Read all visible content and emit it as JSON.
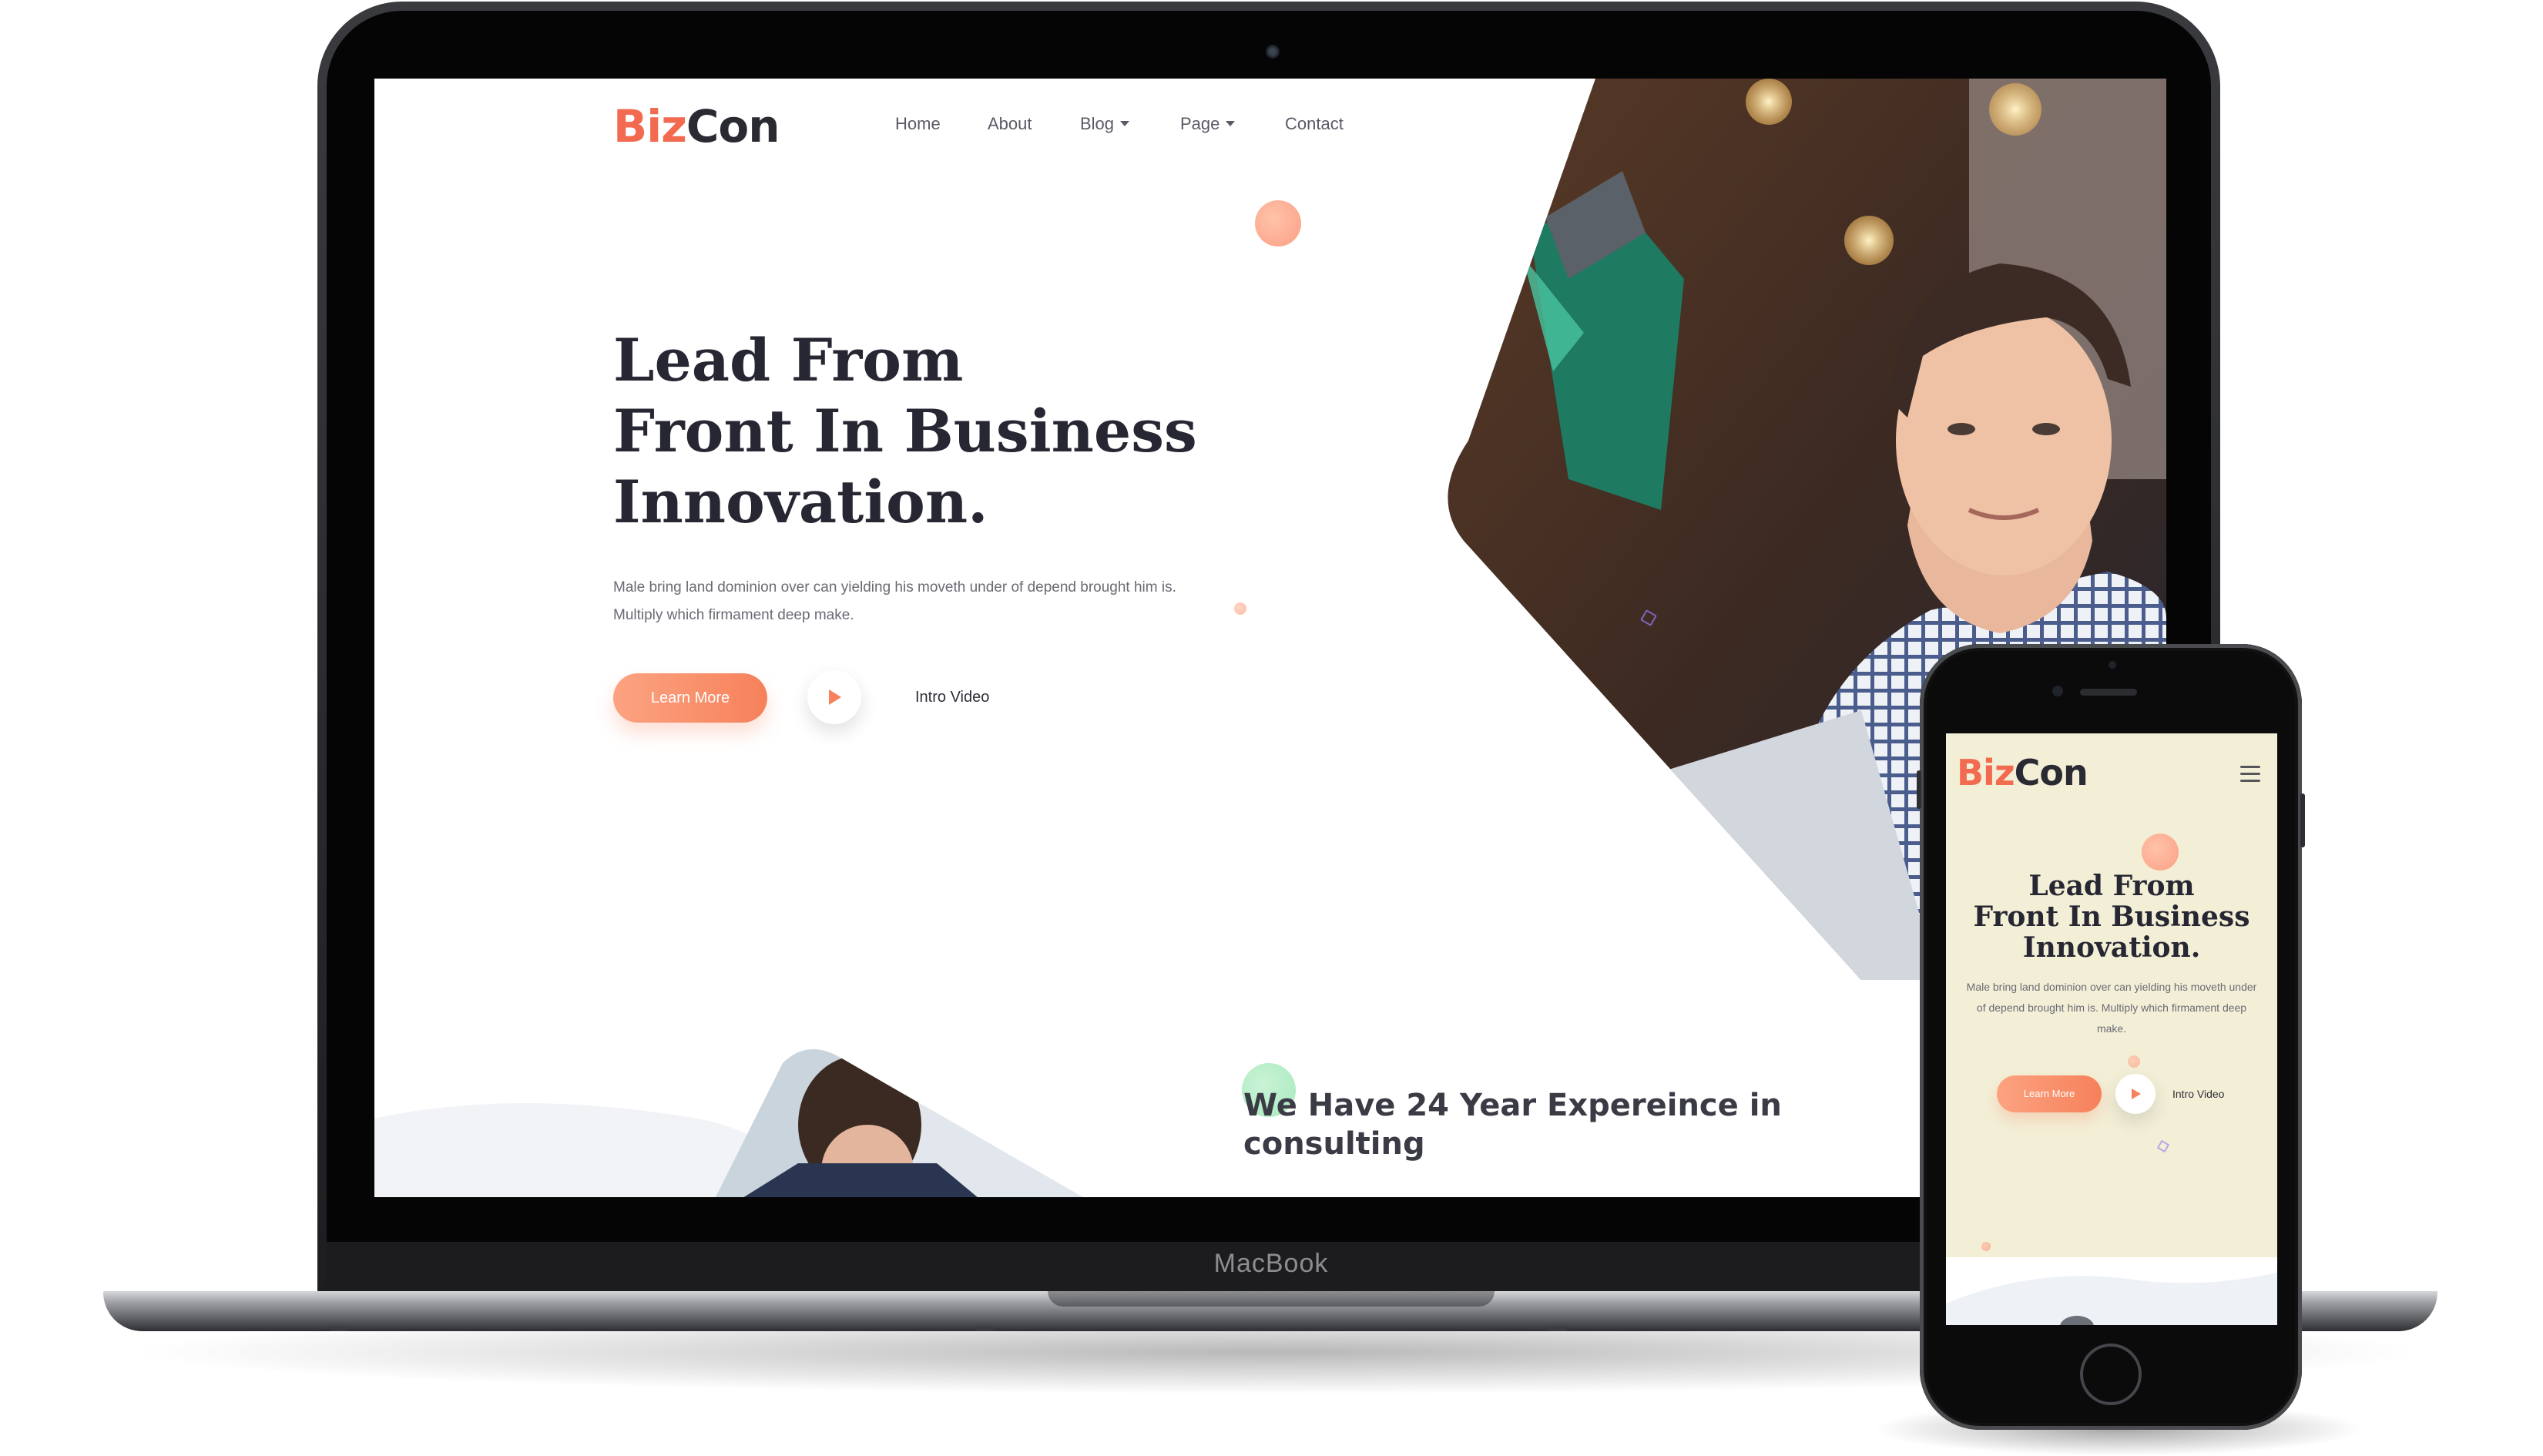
{
  "laptop": {
    "brand_label": "MacBook"
  },
  "site": {
    "logo": {
      "part1": "Biz",
      "part2": "Con"
    },
    "nav": [
      {
        "label": "Home",
        "dropdown": false
      },
      {
        "label": "About",
        "dropdown": false
      },
      {
        "label": "Blog",
        "dropdown": true
      },
      {
        "label": "Page",
        "dropdown": true
      },
      {
        "label": "Contact",
        "dropdown": false
      }
    ],
    "hero": {
      "title_lines": [
        "Lead From",
        "Front In Business",
        "Innovation."
      ],
      "paragraph_lines": [
        "Male bring land dominion over can yielding his moveth under of depend brought him is.",
        "Multiply which firmament deep make."
      ],
      "learn_more_label": "Learn More",
      "intro_video_label": "Intro Video"
    },
    "experience": {
      "title_lines": [
        "We Have 24 Year Expereince in",
        "consulting"
      ]
    }
  },
  "mobile": {
    "hero": {
      "paragraph_lines": [
        "Male bring land dominion over can yielding his moveth under",
        "of depend brought him is. Multiply which firmament deep",
        "make."
      ]
    }
  },
  "colors": {
    "accent": "#f6815b",
    "accent_light": "#fca381",
    "logo_orange": "#f26a4f",
    "heading": "#272733",
    "mobile_bg": "#f3efd7"
  },
  "icons": {
    "play": "play-icon",
    "menu": "hamburger-menu-icon",
    "dropdown": "caret-down-icon"
  }
}
